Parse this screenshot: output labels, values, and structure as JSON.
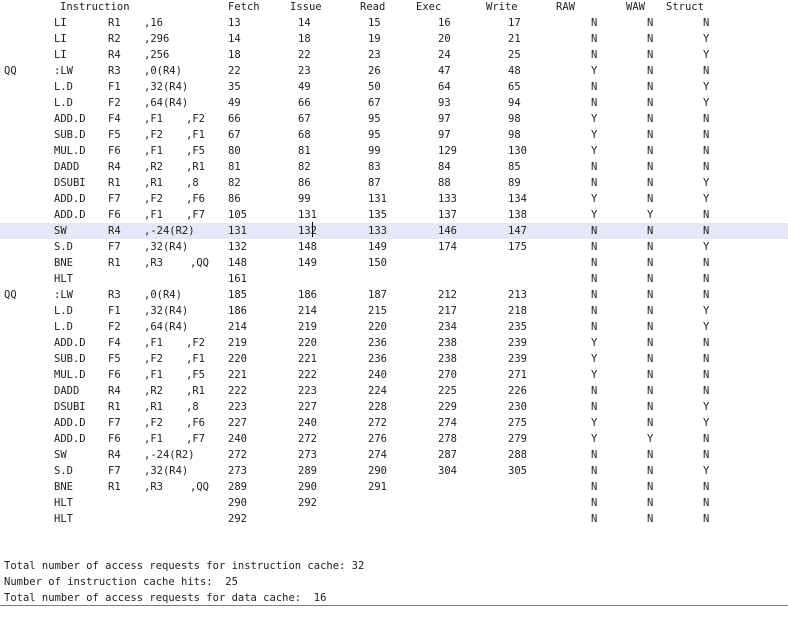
{
  "header": {
    "instruction": "Instruction",
    "fetch": "Fetch",
    "issue": "Issue",
    "read": "Read",
    "exec": "Exec",
    "write": "Write",
    "raw": "RAW",
    "waw": "WAW",
    "struct": "Struct"
  },
  "rows": [
    {
      "label": "",
      "op": "LI",
      "r": "R1",
      "a1": ",16",
      "a2": "",
      "a3": "",
      "fetch": "13",
      "issue": "14",
      "read": "15",
      "exec": "16",
      "write": "17",
      "raw": "N",
      "waw": "N",
      "struct": "N"
    },
    {
      "label": "",
      "op": "LI",
      "r": "R2",
      "a1": ",296",
      "a2": "",
      "a3": "",
      "fetch": "14",
      "issue": "18",
      "read": "19",
      "exec": "20",
      "write": "21",
      "raw": "N",
      "waw": "N",
      "struct": "Y"
    },
    {
      "label": "",
      "op": "LI",
      "r": "R4",
      "a1": ",256",
      "a2": "",
      "a3": "",
      "fetch": "18",
      "issue": "22",
      "read": "23",
      "exec": "24",
      "write": "25",
      "raw": "N",
      "waw": "N",
      "struct": "Y"
    },
    {
      "label": "QQ",
      "op": ":LW",
      "r": "R3",
      "a1": ",0(R4)",
      "a2": "",
      "a3": "",
      "fetch": "22",
      "issue": "23",
      "read": "26",
      "exec": "47",
      "write": "48",
      "raw": "Y",
      "waw": "N",
      "struct": "N"
    },
    {
      "label": "",
      "op": "L.D",
      "r": "F1",
      "a1": ",32(R4)",
      "a2": "",
      "a3": "",
      "fetch": "35",
      "issue": "49",
      "read": "50",
      "exec": "64",
      "write": "65",
      "raw": "N",
      "waw": "N",
      "struct": "Y"
    },
    {
      "label": "",
      "op": "L.D",
      "r": "F2",
      "a1": ",64(R4)",
      "a2": "",
      "a3": "",
      "fetch": "49",
      "issue": "66",
      "read": "67",
      "exec": "93",
      "write": "94",
      "raw": "N",
      "waw": "N",
      "struct": "Y"
    },
    {
      "label": "",
      "op": "ADD.D",
      "r": "F4",
      "a1": ",F1",
      "a2": ",F2",
      "a3": "",
      "fetch": "66",
      "issue": "67",
      "read": "95",
      "exec": "97",
      "write": "98",
      "raw": "Y",
      "waw": "N",
      "struct": "N"
    },
    {
      "label": "",
      "op": "SUB.D",
      "r": "F5",
      "a1": ",F2",
      "a2": ",F1",
      "a3": "",
      "fetch": "67",
      "issue": "68",
      "read": "95",
      "exec": "97",
      "write": "98",
      "raw": "Y",
      "waw": "N",
      "struct": "N"
    },
    {
      "label": "",
      "op": "MUL.D",
      "r": "F6",
      "a1": ",F1",
      "a2": ",F5",
      "a3": "",
      "fetch": "80",
      "issue": "81",
      "read": "99",
      "exec": "129",
      "write": "130",
      "raw": "Y",
      "waw": "N",
      "struct": "N"
    },
    {
      "label": "",
      "op": "DADD",
      "r": "R4",
      "a1": ",R2",
      "a2": ",R1",
      "a3": "",
      "fetch": "81",
      "issue": "82",
      "read": "83",
      "exec": "84",
      "write": "85",
      "raw": "N",
      "waw": "N",
      "struct": "N"
    },
    {
      "label": "",
      "op": "DSUBI",
      "r": "R1",
      "a1": ",R1",
      "a2": ",8",
      "a3": "",
      "fetch": "82",
      "issue": "86",
      "read": "87",
      "exec": "88",
      "write": "89",
      "raw": "N",
      "waw": "N",
      "struct": "Y"
    },
    {
      "label": "",
      "op": "ADD.D",
      "r": "F7",
      "a1": ",F2",
      "a2": ",F6",
      "a3": "",
      "fetch": "86",
      "issue": "99",
      "read": "131",
      "exec": "133",
      "write": "134",
      "raw": "Y",
      "waw": "N",
      "struct": "Y"
    },
    {
      "label": "",
      "op": "ADD.D",
      "r": "F6",
      "a1": ",F1",
      "a2": ",F7",
      "a3": "",
      "fetch": "105",
      "issue": "131",
      "read": "135",
      "exec": "137",
      "write": "138",
      "raw": "Y",
      "waw": "Y",
      "struct": "N"
    },
    {
      "label": "",
      "op": "SW",
      "r": "R4",
      "a1": ",-24(R2)",
      "a2": "",
      "a3": "",
      "fetch": "131",
      "issue": "132",
      "read": "133",
      "exec": "146",
      "write": "147",
      "raw": "N",
      "waw": "N",
      "struct": "N"
    },
    {
      "label": "",
      "op": "S.D",
      "r": "F7",
      "a1": ",32(R4)",
      "a2": "",
      "a3": "",
      "fetch": "132",
      "issue": "148",
      "read": "149",
      "exec": "174",
      "write": "175",
      "raw": "N",
      "waw": "N",
      "struct": "Y"
    },
    {
      "label": "",
      "op": "BNE",
      "r": "R1",
      "a1": ",R3",
      "a2": "",
      "a3": ",QQ",
      "fetch": "148",
      "issue": "149",
      "read": "150",
      "exec": "",
      "write": "",
      "raw": "N",
      "waw": "N",
      "struct": "N"
    },
    {
      "label": "",
      "op": "HLT",
      "r": "",
      "a1": "",
      "a2": "",
      "a3": "",
      "fetch": "161",
      "issue": "",
      "read": "",
      "exec": "",
      "write": "",
      "raw": "N",
      "waw": "N",
      "struct": "N"
    },
    {
      "label": "QQ",
      "op": ":LW",
      "r": "R3",
      "a1": ",0(R4)",
      "a2": "",
      "a3": "",
      "fetch": "185",
      "issue": "186",
      "read": "187",
      "exec": "212",
      "write": "213",
      "raw": "N",
      "waw": "N",
      "struct": "N"
    },
    {
      "label": "",
      "op": "L.D",
      "r": "F1",
      "a1": ",32(R4)",
      "a2": "",
      "a3": "",
      "fetch": "186",
      "issue": "214",
      "read": "215",
      "exec": "217",
      "write": "218",
      "raw": "N",
      "waw": "N",
      "struct": "Y"
    },
    {
      "label": "",
      "op": "L.D",
      "r": "F2",
      "a1": ",64(R4)",
      "a2": "",
      "a3": "",
      "fetch": "214",
      "issue": "219",
      "read": "220",
      "exec": "234",
      "write": "235",
      "raw": "N",
      "waw": "N",
      "struct": "Y"
    },
    {
      "label": "",
      "op": "ADD.D",
      "r": "F4",
      "a1": ",F1",
      "a2": ",F2",
      "a3": "",
      "fetch": "219",
      "issue": "220",
      "read": "236",
      "exec": "238",
      "write": "239",
      "raw": "Y",
      "waw": "N",
      "struct": "N"
    },
    {
      "label": "",
      "op": "SUB.D",
      "r": "F5",
      "a1": ",F2",
      "a2": ",F1",
      "a3": "",
      "fetch": "220",
      "issue": "221",
      "read": "236",
      "exec": "238",
      "write": "239",
      "raw": "Y",
      "waw": "N",
      "struct": "N"
    },
    {
      "label": "",
      "op": "MUL.D",
      "r": "F6",
      "a1": ",F1",
      "a2": ",F5",
      "a3": "",
      "fetch": "221",
      "issue": "222",
      "read": "240",
      "exec": "270",
      "write": "271",
      "raw": "Y",
      "waw": "N",
      "struct": "N"
    },
    {
      "label": "",
      "op": "DADD",
      "r": "R4",
      "a1": ",R2",
      "a2": ",R1",
      "a3": "",
      "fetch": "222",
      "issue": "223",
      "read": "224",
      "exec": "225",
      "write": "226",
      "raw": "N",
      "waw": "N",
      "struct": "N"
    },
    {
      "label": "",
      "op": "DSUBI",
      "r": "R1",
      "a1": ",R1",
      "a2": ",8",
      "a3": "",
      "fetch": "223",
      "issue": "227",
      "read": "228",
      "exec": "229",
      "write": "230",
      "raw": "N",
      "waw": "N",
      "struct": "Y"
    },
    {
      "label": "",
      "op": "ADD.D",
      "r": "F7",
      "a1": ",F2",
      "a2": ",F6",
      "a3": "",
      "fetch": "227",
      "issue": "240",
      "read": "272",
      "exec": "274",
      "write": "275",
      "raw": "Y",
      "waw": "N",
      "struct": "Y"
    },
    {
      "label": "",
      "op": "ADD.D",
      "r": "F6",
      "a1": ",F1",
      "a2": ",F7",
      "a3": "",
      "fetch": "240",
      "issue": "272",
      "read": "276",
      "exec": "278",
      "write": "279",
      "raw": "Y",
      "waw": "Y",
      "struct": "N"
    },
    {
      "label": "",
      "op": "SW",
      "r": "R4",
      "a1": ",-24(R2)",
      "a2": "",
      "a3": "",
      "fetch": "272",
      "issue": "273",
      "read": "274",
      "exec": "287",
      "write": "288",
      "raw": "N",
      "waw": "N",
      "struct": "N"
    },
    {
      "label": "",
      "op": "S.D",
      "r": "F7",
      "a1": ",32(R4)",
      "a2": "",
      "a3": "",
      "fetch": "273",
      "issue": "289",
      "read": "290",
      "exec": "304",
      "write": "305",
      "raw": "N",
      "waw": "N",
      "struct": "Y"
    },
    {
      "label": "",
      "op": "BNE",
      "r": "R1",
      "a1": ",R3",
      "a2": "",
      "a3": ",QQ",
      "fetch": "289",
      "issue": "290",
      "read": "291",
      "exec": "",
      "write": "",
      "raw": "N",
      "waw": "N",
      "struct": "N"
    },
    {
      "label": "",
      "op": "HLT",
      "r": "",
      "a1": "",
      "a2": "",
      "a3": "",
      "fetch": "290",
      "issue": "292",
      "read": "",
      "exec": "",
      "write": "",
      "raw": "N",
      "waw": "N",
      "struct": "N"
    },
    {
      "label": "",
      "op": "HLT",
      "r": "",
      "a1": "",
      "a2": "",
      "a3": "",
      "fetch": "292",
      "issue": "",
      "read": "",
      "exec": "",
      "write": "",
      "raw": "N",
      "waw": "N",
      "struct": "N"
    }
  ],
  "summary": [
    "Total number of access requests for instruction cache: 32",
    "Number of instruction cache hits:  25",
    "Total number of access requests for data cache:  16"
  ]
}
